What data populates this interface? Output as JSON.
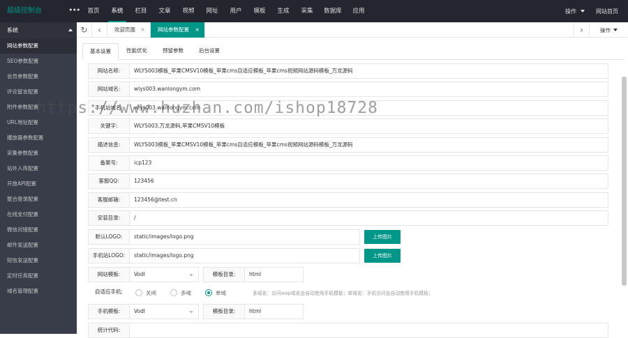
{
  "topbar": {
    "brand": "超级控制台",
    "more": "•••",
    "nav": [
      "首页",
      "系统",
      "栏目",
      "文章",
      "视频",
      "网址",
      "用户",
      "模板",
      "生成",
      "采集",
      "数据库",
      "应用"
    ],
    "active_nav": "系统",
    "ops": "操作",
    "home": "网站首页"
  },
  "sidebar": {
    "header": "系统",
    "items": [
      "网站参数配置",
      "SEO参数配置",
      "会员参数配置",
      "评论留言配置",
      "附件参数配置",
      "URL地址配置",
      "播放器参数配置",
      "采集参数配置",
      "站外入库配置",
      "开放API配置",
      "整合登录配置",
      "在线支付配置",
      "微信对接配置",
      "邮件发送配置",
      "短信发送配置",
      "定时任务配置",
      "域名管理配置"
    ],
    "active": "网站参数配置"
  },
  "tabs": {
    "tab1": "欢迎页面",
    "tab2": "网站参数配置",
    "close": "×",
    "ops": "操作"
  },
  "subtabs": [
    "基本设置",
    "性能优化",
    "预留参数",
    "后台设置"
  ],
  "form": {
    "site_name": {
      "label": "网站名称:",
      "value": "WLYS003模板_苹果CMSV10模板_苹果cms自适应模板_苹果cms视频网站源码模板_万龙源码"
    },
    "site_domain": {
      "label": "网站域名:",
      "value": "wlys003.wanlongym.com"
    },
    "mobile_domain": {
      "label": "手机站域名:",
      "value": "wlys003.wanlongym.com"
    },
    "keywords": {
      "label": "关键字:",
      "value": "WLYS003,万龙源码,苹果CMSV10模板"
    },
    "description": {
      "label": "描述信息:",
      "value": "WLYS003模板_苹果CMSV10模板_苹果cms自适应模板_苹果cms视频网站源码模板_万龙源码"
    },
    "icp": {
      "label": "备案号:",
      "value": "icp123"
    },
    "qq": {
      "label": "客服QQ:",
      "value": "123456"
    },
    "email": {
      "label": "客服邮箱:",
      "value": "123456@test.cn"
    },
    "install_dir": {
      "label": "安装目录:",
      "value": "/"
    },
    "logo": {
      "label": "默认LOGO:",
      "value": "static/images/logo.png",
      "button": "上传图片"
    },
    "mobile_logo": {
      "label": "手机站LOGO:",
      "value": "static/images/logo.png",
      "button": "上传图片"
    },
    "template": {
      "label": "网站模板:",
      "value": "Vodl",
      "dir_label": "模板目录:",
      "dir_value": "html"
    },
    "adapt": {
      "label": "自适应手机:",
      "options": [
        "关闭",
        "多域",
        "单域"
      ],
      "selected": "单域",
      "hint": "多域名：访问wap域名会自动使用手机模板；单域名：手机访问会自动使用手机模板；"
    },
    "mobile_template": {
      "label": "手机模板:",
      "value": "Vodl",
      "dir_label": "模板目录:",
      "dir_value": "html"
    },
    "stats": {
      "label": "统计代码:"
    }
  },
  "watermark": "https://www.huzhan.com/ishop18728",
  "colors": {
    "accent": "#009688",
    "topbar": "#23262e",
    "sidebar": "#393d49"
  }
}
